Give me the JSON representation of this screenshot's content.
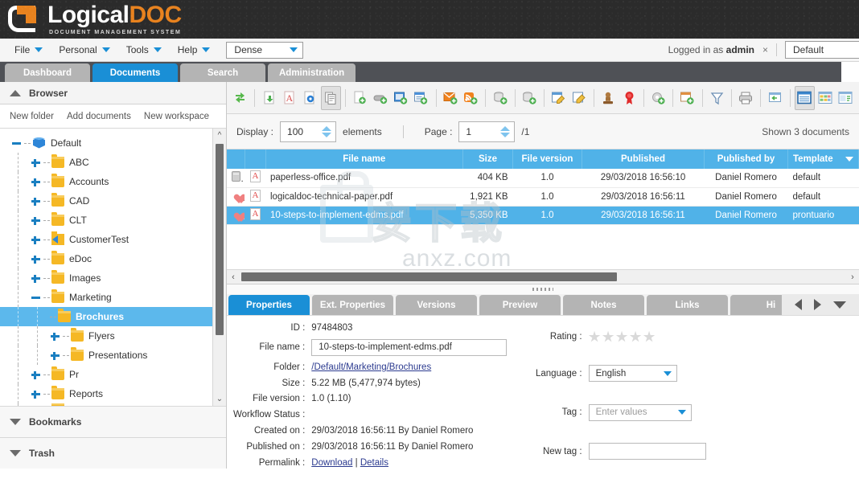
{
  "app": {
    "brand_primary": "LogicalD",
    "brand_word_white": "Logical",
    "brand_word_orange": "DOC",
    "tagline": "DOCUMENT MANAGEMENT SYSTEM",
    "accent_blue": "#1a8fd6",
    "grid_blue": "#50b2e8",
    "orange": "#e8821e"
  },
  "menubar": {
    "items": [
      {
        "label": "File"
      },
      {
        "label": "Personal"
      },
      {
        "label": "Tools"
      },
      {
        "label": "Help"
      }
    ],
    "density_select": "Dense",
    "logged_in_text": "Logged in as",
    "logged_in_user": "admin",
    "close_icon": "×",
    "workspace_select": "Default"
  },
  "tabs": [
    {
      "label": "Dashboard",
      "active": false
    },
    {
      "label": "Documents",
      "active": true
    },
    {
      "label": "Search",
      "active": false
    },
    {
      "label": "Administration",
      "active": false
    }
  ],
  "sidebar": {
    "browser_title": "Browser",
    "actions": [
      "New folder",
      "Add documents",
      "New workspace"
    ],
    "tree": [
      {
        "label": "Default",
        "depth": 0,
        "toggle": "minus",
        "icon": "cube",
        "selected": false
      },
      {
        "label": "ABC",
        "depth": 1,
        "toggle": "plus",
        "icon": "folder",
        "selected": false
      },
      {
        "label": "Accounts",
        "depth": 1,
        "toggle": "plus",
        "icon": "folder",
        "selected": false
      },
      {
        "label": "CAD",
        "depth": 1,
        "toggle": "plus",
        "icon": "folder",
        "selected": false
      },
      {
        "label": "CLT",
        "depth": 1,
        "toggle": "plus",
        "icon": "folder",
        "selected": false
      },
      {
        "label": "CustomerTest",
        "depth": 1,
        "toggle": "plus",
        "icon": "flag",
        "selected": false
      },
      {
        "label": "eDoc",
        "depth": 1,
        "toggle": "plus",
        "icon": "folder",
        "selected": false
      },
      {
        "label": "Images",
        "depth": 1,
        "toggle": "plus",
        "icon": "folder",
        "selected": false
      },
      {
        "label": "Marketing",
        "depth": 1,
        "toggle": "minus",
        "icon": "folder",
        "selected": false
      },
      {
        "label": "Brochures",
        "depth": 2,
        "toggle": "none",
        "icon": "folder",
        "selected": true
      },
      {
        "label": "Flyers",
        "depth": 2,
        "toggle": "plus",
        "icon": "folder",
        "selected": false
      },
      {
        "label": "Presentations",
        "depth": 2,
        "toggle": "plus",
        "icon": "folder",
        "selected": false
      },
      {
        "label": "Pr",
        "depth": 1,
        "toggle": "plus",
        "icon": "folder",
        "selected": false
      },
      {
        "label": "Reports",
        "depth": 1,
        "toggle": "plus",
        "icon": "folder",
        "selected": false
      }
    ],
    "bookmarks_label": "Bookmarks",
    "trash_label": "Trash"
  },
  "toolbar": {
    "icons": [
      {
        "name": "refresh-icon"
      },
      {
        "sep": true
      },
      {
        "name": "download-document-icon"
      },
      {
        "name": "export-pdf-icon"
      },
      {
        "name": "document-settings-icon"
      },
      {
        "name": "copy-document-icon",
        "pressed": true
      },
      {
        "sep": true
      },
      {
        "name": "add-document-icon"
      },
      {
        "name": "scan-document-icon"
      },
      {
        "name": "add-screenshot-icon"
      },
      {
        "name": "add-form-icon"
      },
      {
        "sep": true
      },
      {
        "name": "add-email-icon"
      },
      {
        "name": "add-rss-feed-icon"
      },
      {
        "sep": true
      },
      {
        "name": "add-archive-icon"
      },
      {
        "sep": true
      },
      {
        "name": "add-bundle-icon"
      },
      {
        "sep": true
      },
      {
        "name": "edit-note-icon"
      },
      {
        "name": "edit-document-icon"
      },
      {
        "sep": true
      },
      {
        "name": "stamp-icon"
      },
      {
        "name": "digital-signature-icon"
      },
      {
        "sep": true
      },
      {
        "name": "workflow-settings-icon"
      },
      {
        "sep": true
      },
      {
        "name": "add-calendar-event-icon"
      },
      {
        "sep": true
      },
      {
        "name": "filter-icon"
      },
      {
        "sep": true
      },
      {
        "name": "print-icon"
      },
      {
        "sep": true
      },
      {
        "name": "export-csv-icon"
      },
      {
        "sep": true
      },
      {
        "name": "list-view-icon",
        "pressed": true
      },
      {
        "name": "gallery-view-icon"
      },
      {
        "name": "preview-view-icon"
      }
    ]
  },
  "displaybar": {
    "display_label": "Display :",
    "display_value": "100",
    "elements_label": "elements",
    "page_label": "Page :",
    "page_value": "1",
    "page_total": "/1",
    "shown_documents": "Shown 3 documents"
  },
  "grid": {
    "columns": [
      "",
      "",
      "File name",
      "Size",
      "File version",
      "Published",
      "Published by",
      "Template"
    ],
    "rows": [
      {
        "flag": "lock",
        "type": "pdf",
        "file_name": "paperless-office.pdf",
        "size": "404 KB",
        "file_version": "1.0",
        "published": "29/03/2018 16:56:10",
        "published_by": "Daniel Romero",
        "template": "default",
        "selected": false
      },
      {
        "flag": "heart",
        "type": "pdf",
        "file_name": "logicaldoc-technical-paper.pdf",
        "size": "1,921 KB",
        "file_version": "1.0",
        "published": "29/03/2018 16:56:11",
        "published_by": "Daniel Romero",
        "template": "default",
        "selected": false
      },
      {
        "flag": "heart",
        "type": "pdf",
        "file_name": "10-steps-to-implement-edms.pdf",
        "size": "5,350 KB",
        "file_version": "1.0",
        "published": "29/03/2018 16:56:11",
        "published_by": "Daniel Romero",
        "template": "prontuario",
        "selected": true
      }
    ],
    "watermark_cn": "安下载",
    "watermark_en": "anxz.com"
  },
  "detail_tabs": [
    {
      "label": "Properties",
      "active": true
    },
    {
      "label": "Ext. Properties",
      "active": false
    },
    {
      "label": "Versions",
      "active": false
    },
    {
      "label": "Preview",
      "active": false
    },
    {
      "label": "Notes",
      "active": false
    },
    {
      "label": "Links",
      "active": false
    },
    {
      "label": "Hi",
      "active": false
    }
  ],
  "properties": {
    "id_label": "ID :",
    "id_value": "97484803",
    "filename_label": "File name :",
    "filename_value": "10-steps-to-implement-edms.pdf",
    "folder_label": "Folder :",
    "folder_value": "/Default/Marketing/Brochures",
    "size_label": "Size :",
    "size_value": "5.22 MB (5,477,974 bytes)",
    "version_label": "File version :",
    "version_value": "1.0 (1.10)",
    "workflow_label": "Workflow Status :",
    "workflow_value": "",
    "created_label": "Created on :",
    "created_value": "29/03/2018 16:56:11 By Daniel Romero",
    "published_label": "Published on :",
    "published_value": "29/03/2018 16:56:11 By Daniel Romero",
    "permalink_label": "Permalink :",
    "permalink_download": "Download",
    "permalink_sep": "|",
    "permalink_details": "Details",
    "rating_label": "Rating :",
    "rating_stars": 5,
    "rating_value": 0,
    "language_label": "Language :",
    "language_value": "English",
    "tag_label": "Tag :",
    "tag_placeholder": "Enter values",
    "newtag_label": "New tag :",
    "newtag_value": ""
  }
}
